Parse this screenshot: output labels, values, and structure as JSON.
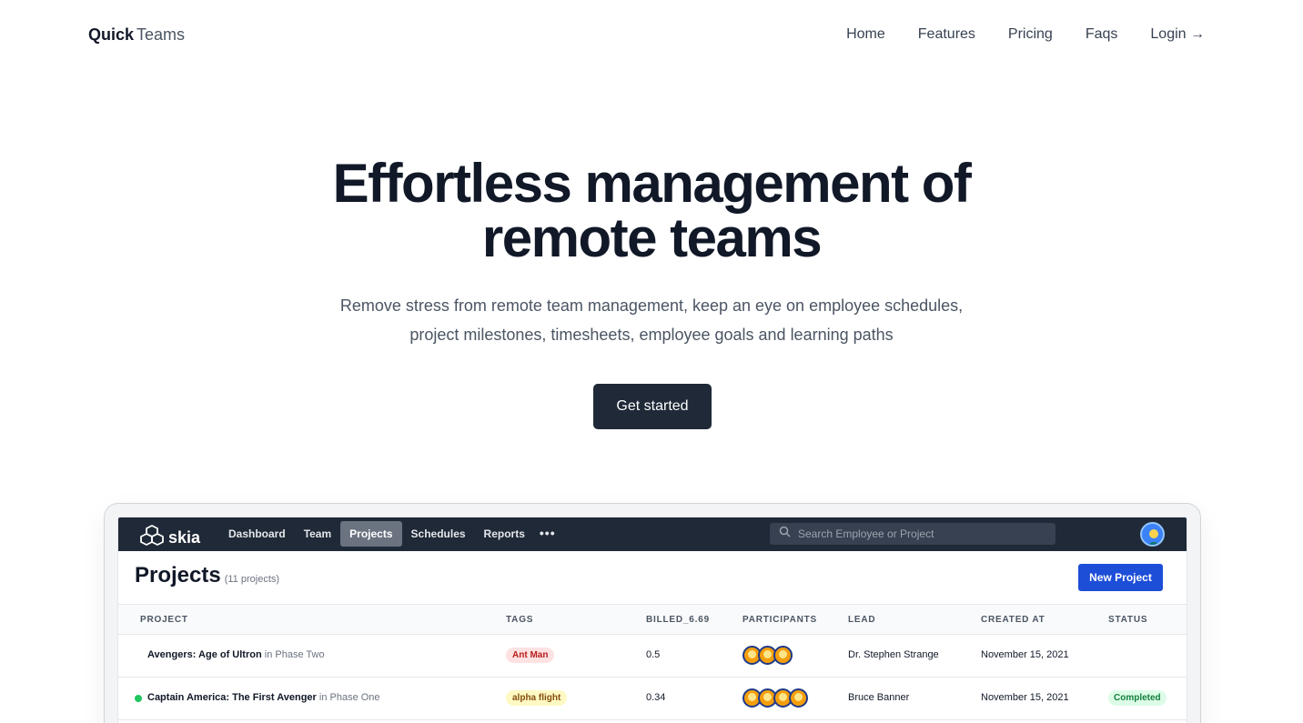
{
  "brand": {
    "bold": "Quick",
    "light": "Teams"
  },
  "nav": [
    {
      "label": "Home"
    },
    {
      "label": "Features"
    },
    {
      "label": "Pricing"
    },
    {
      "label": "Faqs"
    },
    {
      "label": "Login →"
    }
  ],
  "hero": {
    "title_line1": "Effortless management of",
    "title_line2": "remote teams",
    "subtitle_line1": "Remove stress from remote team management, keep an eye on employee schedules,",
    "subtitle_line2": "project milestones, timesheets, employee goals and learning paths",
    "cta_label": "Get started"
  },
  "app": {
    "logo_text": "skia",
    "tabs": [
      "Dashboard",
      "Team",
      "Projects",
      "Schedules",
      "Reports"
    ],
    "active_tab": "Projects",
    "more_label": "•••",
    "search_placeholder": "Search Employee or Project",
    "page_title": "Projects",
    "project_count": "(11 projects)",
    "new_button": "New Project",
    "columns": [
      "PROJECT",
      "TAGS",
      "BILLED_6.69",
      "PARTICIPANTS",
      "LEAD",
      "CREATED AT",
      "STATUS"
    ],
    "rows": [
      {
        "name": "Avengers: Age of Ultron",
        "phase": "in Phase Two",
        "tag": "Ant Man",
        "tag_color": "#fee2e2",
        "billed": "0.5",
        "participants": 3,
        "lead": "Dr. Stephen Strange",
        "created": "November 15, 2021",
        "status": ""
      },
      {
        "name": "Captain America: The First Avenger",
        "phase": "in Phase One",
        "tag": "alpha flight",
        "tag_color": "#fef9c3",
        "billed": "0.34",
        "participants": 4,
        "lead": "Bruce Banner",
        "created": "November 15, 2021",
        "status": "Completed"
      }
    ]
  }
}
